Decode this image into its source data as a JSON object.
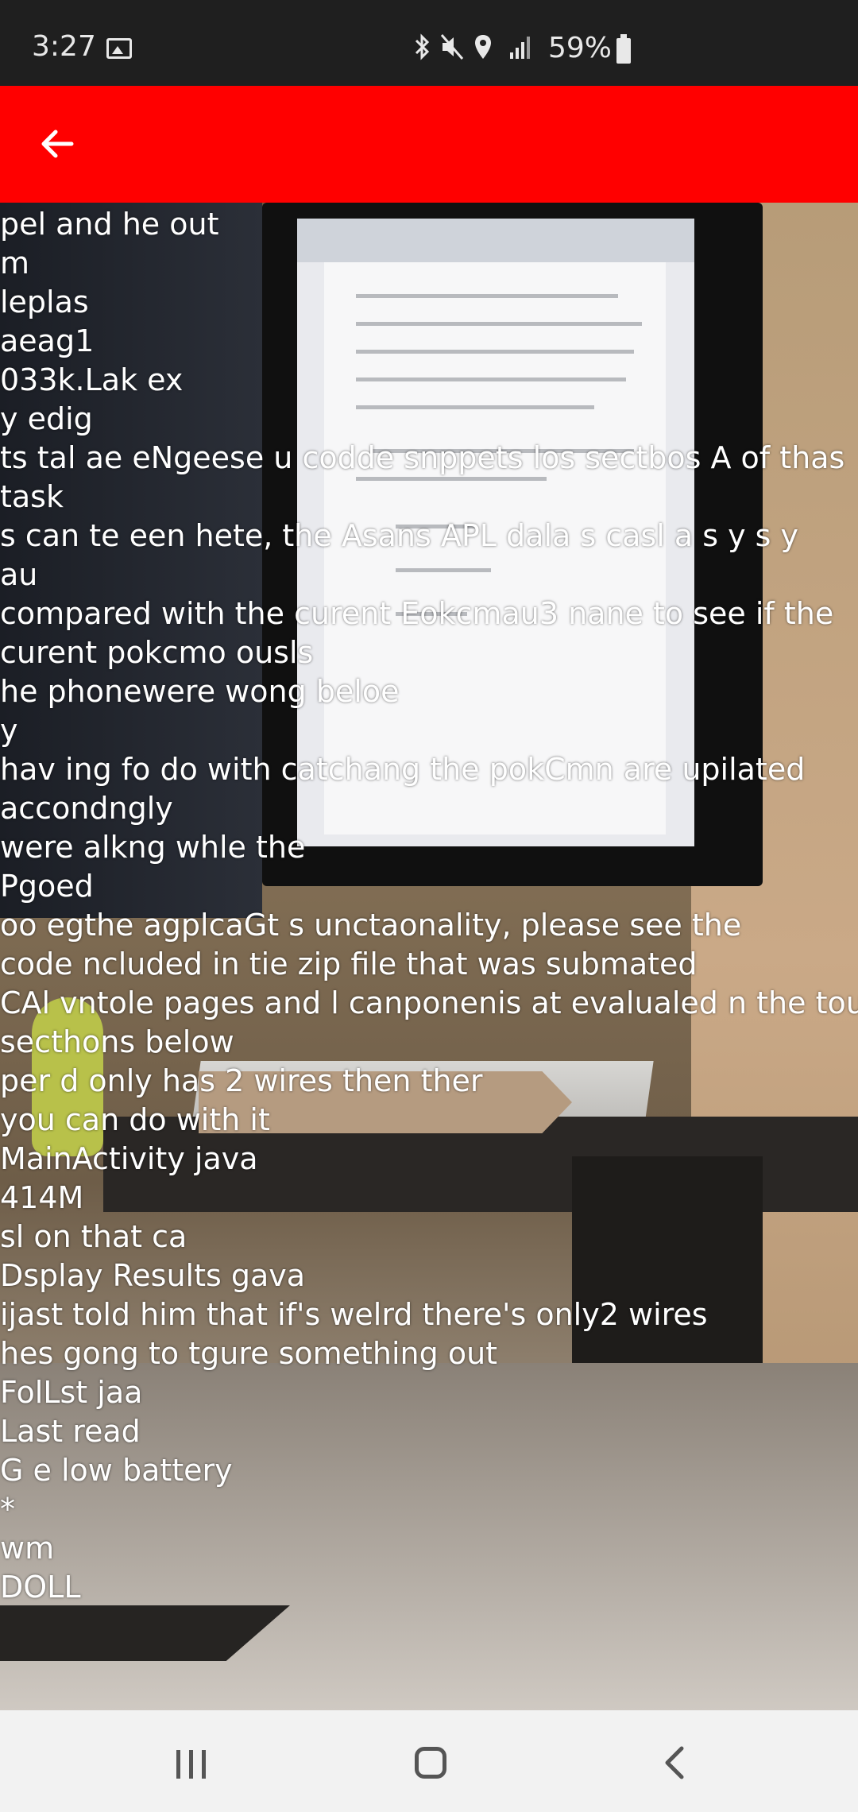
{
  "status_bar": {
    "time": "3:27",
    "battery_percent": "59%",
    "icons": [
      "bluetooth-icon",
      "mute-icon",
      "location-icon",
      "lte-signal-icon",
      "battery-icon"
    ]
  },
  "app_bar": {
    "color": "#ff0000",
    "back_icon": "arrow-left-icon"
  },
  "ocr_lines": [
    "pel and he out",
    "m",
    "leplas",
    "aeag1",
    "033k.Lak ex",
    "y edig",
    "ts tal ae eNgeese u codde snppets los sectbos A of thas",
    "task",
    "s can te een hete, the Asans APL dala s casl a s y s y",
    "au",
    "compared with the curent Eokcmau3 nane to see if the",
    "curent pokcmo ousls",
    "he phonewere wong beloe",
    "y",
    "hav ing fo do with catchang the pokCmn are upilated",
    "accondngly",
    "were alkng whle the",
    "Pgoed",
    "oo egthe agplcaGt s unctaonality, please see the",
    "code ncluded in tie zip file that was submated",
    "CAl vntole pages and l canponenis at evalualed n the tour",
    "secthons below",
    "per d only has 2 wires then ther",
    "you can do with it",
    "MainActivity java",
    "414M",
    "sl on that ca",
    "Dsplay Results gava",
    "ijast told him that if's welrd there's only2 wires",
    "hes gong to tgure something out",
    "FolLst jaa",
    "Last read",
    "G e low battery",
    "*",
    "wm",
    "DOLL"
  ],
  "nav_bar": {
    "icons": [
      "recent-apps-icon",
      "home-icon",
      "back-icon"
    ]
  }
}
